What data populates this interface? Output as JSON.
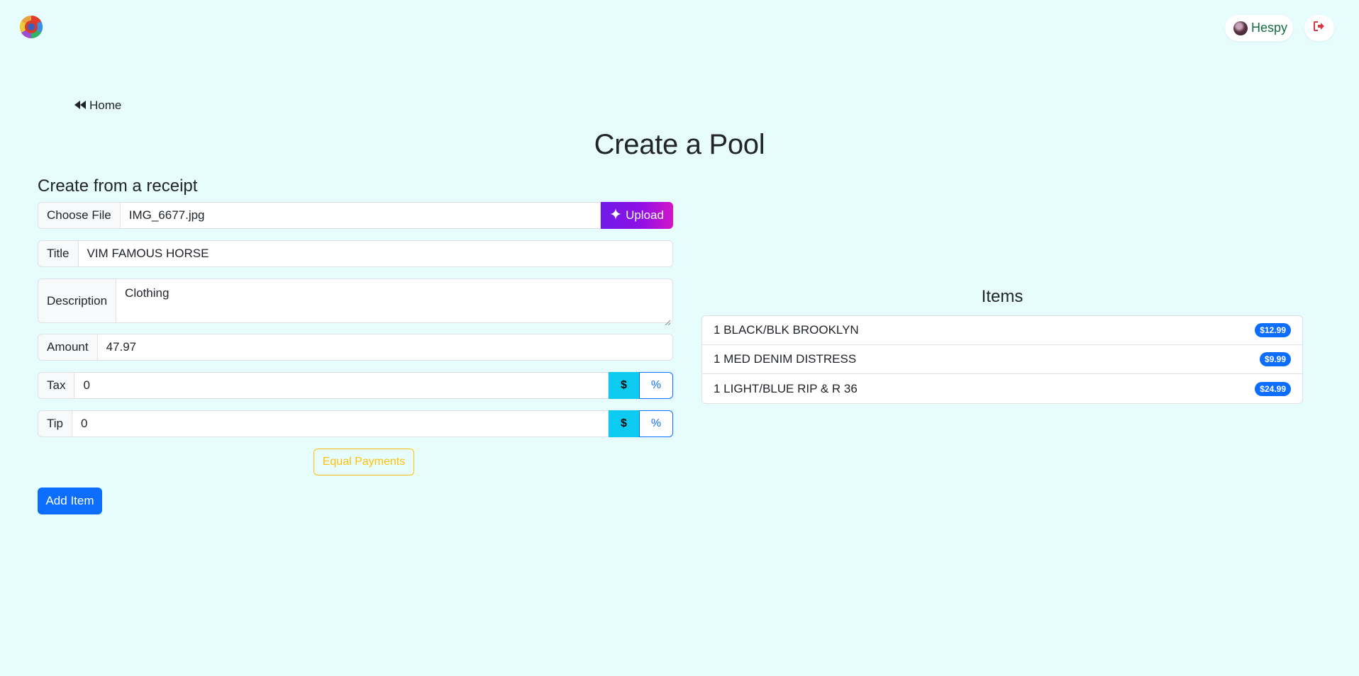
{
  "header": {
    "logo_icon": "colorful-wheel-logo",
    "user_name": "Hespy",
    "logout_icon": "sign-out-icon"
  },
  "nav": {
    "home_label": "Home",
    "home_icon": "backward-icon"
  },
  "page": {
    "title": "Create a Pool",
    "section_title": "Create from a receipt"
  },
  "form": {
    "file": {
      "button_label": "Choose File",
      "file_name": "IMG_6677.jpg",
      "upload_label": "Upload",
      "upload_icon": "sparkle-icon"
    },
    "title": {
      "label": "Title",
      "value": "VIM FAMOUS HORSE"
    },
    "description": {
      "label": "Description",
      "value": "Clothing"
    },
    "amount": {
      "label": "Amount",
      "value": "47.97"
    },
    "tax": {
      "label": "Tax",
      "value": "0",
      "dollar_label": "$",
      "percent_label": "%"
    },
    "tip": {
      "label": "Tip",
      "value": "0",
      "dollar_label": "$",
      "percent_label": "%"
    },
    "equal_payments_label": "Equal Payments",
    "add_item_label": "Add Item"
  },
  "items": {
    "title": "Items",
    "rows": [
      {
        "name": "1 BLACK/BLK BROOKLYN",
        "price": "$12.99"
      },
      {
        "name": "1 MED DENIM DISTRESS",
        "price": "$9.99"
      },
      {
        "name": "1 LIGHT/BLUE RIP & R 36",
        "price": "$24.99"
      }
    ]
  },
  "colors": {
    "background": "#e7fdfd",
    "primary": "#0d6efd",
    "info": "#0dcaf0",
    "warning": "#ffc107",
    "user_text": "#146c43",
    "danger": "#dc3545",
    "upload_gradient_start": "#6f1be8",
    "upload_gradient_end": "#d315c8"
  }
}
